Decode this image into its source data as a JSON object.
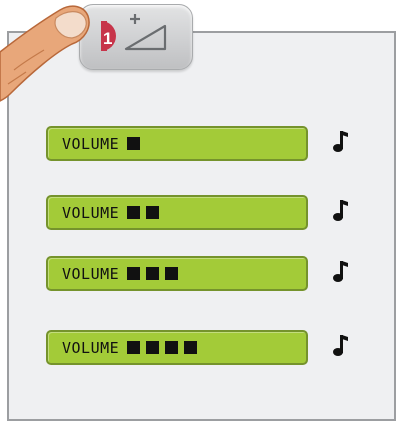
{
  "volume_options": [
    {
      "label": "VOLUME",
      "level": 1
    },
    {
      "label": "VOLUME",
      "level": 2
    },
    {
      "label": "VOLUME",
      "level": 3
    },
    {
      "label": "VOLUME",
      "level": 4
    }
  ],
  "colors": {
    "row_fill": "#a3cb38",
    "row_border": "#75932c",
    "panel_bg": "#eff0f2",
    "panel_border": "#9c9ea1",
    "key_badge": "#c7344a",
    "finger": "#e8a77a"
  },
  "icons": {
    "key_badge": "number-one-badge-icon",
    "key_ramp": "volume-increase-ramp-icon",
    "row_sound": "music-note-icon",
    "pointer": "finger-pointer-icon"
  }
}
